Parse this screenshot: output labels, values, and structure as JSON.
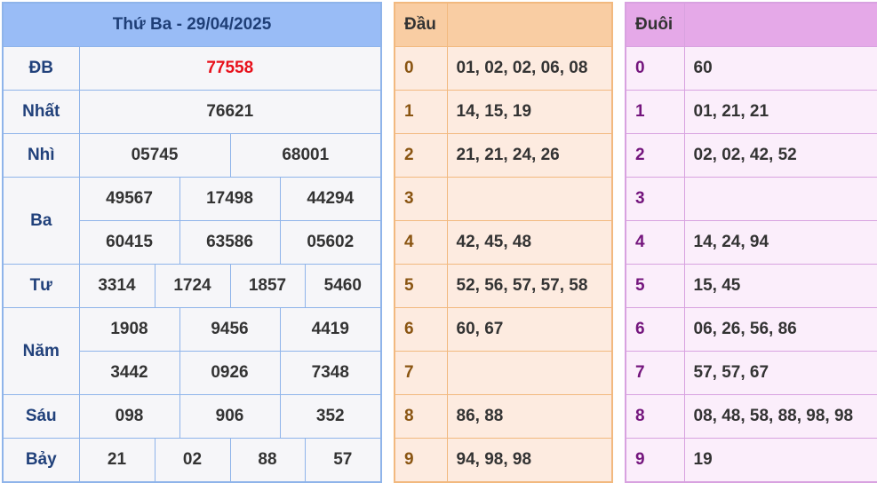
{
  "results": {
    "title": "Thứ Ba - 29/04/2025",
    "db": {
      "label": "ĐB",
      "value": "77558",
      "color": "#e8101a"
    },
    "nhat": {
      "label": "Nhất",
      "values": [
        "76621"
      ]
    },
    "nhi": {
      "label": "Nhì",
      "values": [
        "05745",
        "68001"
      ]
    },
    "ba": {
      "label": "Ba",
      "values": [
        "49567",
        "17498",
        "44294",
        "60415",
        "63586",
        "05602"
      ]
    },
    "tu": {
      "label": "Tư",
      "values": [
        "3314",
        "1724",
        "1857",
        "5460"
      ]
    },
    "nam": {
      "label": "Năm",
      "values": [
        "1908",
        "9456",
        "4419",
        "3442",
        "0926",
        "7348"
      ]
    },
    "sau": {
      "label": "Sáu",
      "values": [
        "098",
        "906",
        "352"
      ]
    },
    "bay": {
      "label": "Bảy",
      "values": [
        "21",
        "02",
        "88",
        "57"
      ]
    }
  },
  "dau": {
    "header": "Đầu",
    "rows": [
      {
        "digit": "0",
        "values": "01, 02, 02, 06, 08"
      },
      {
        "digit": "1",
        "values": "14, 15, 19"
      },
      {
        "digit": "2",
        "values": "21, 21, 24, 26"
      },
      {
        "digit": "3",
        "values": ""
      },
      {
        "digit": "4",
        "values": "42, 45, 48"
      },
      {
        "digit": "5",
        "values": "52, 56, 57, 57, 58"
      },
      {
        "digit": "6",
        "values": "60, 67"
      },
      {
        "digit": "7",
        "values": ""
      },
      {
        "digit": "8",
        "values": "86, 88"
      },
      {
        "digit": "9",
        "values": "94, 98, 98"
      }
    ]
  },
  "duoi": {
    "header": "Đuôi",
    "rows": [
      {
        "digit": "0",
        "values": "60"
      },
      {
        "digit": "1",
        "values": "01, 21, 21"
      },
      {
        "digit": "2",
        "values": "02, 02, 42, 52"
      },
      {
        "digit": "3",
        "values": ""
      },
      {
        "digit": "4",
        "values": "14, 24, 94"
      },
      {
        "digit": "5",
        "values": "15, 45"
      },
      {
        "digit": "6",
        "values": "06, 26, 56, 86"
      },
      {
        "digit": "7",
        "values": "57, 57, 67"
      },
      {
        "digit": "8",
        "values": "08, 48, 58, 88, 98, 98"
      },
      {
        "digit": "9",
        "values": "19"
      }
    ]
  },
  "colors": {
    "results_header": "#99bcf6",
    "results_border": "#8fb4ea",
    "dau_header": "#f9cda3",
    "dau_body": "#fdebe0",
    "duoi_header": "#e5a9e8",
    "duoi_body": "#fbeefb",
    "special_prize": "#e8101a"
  }
}
